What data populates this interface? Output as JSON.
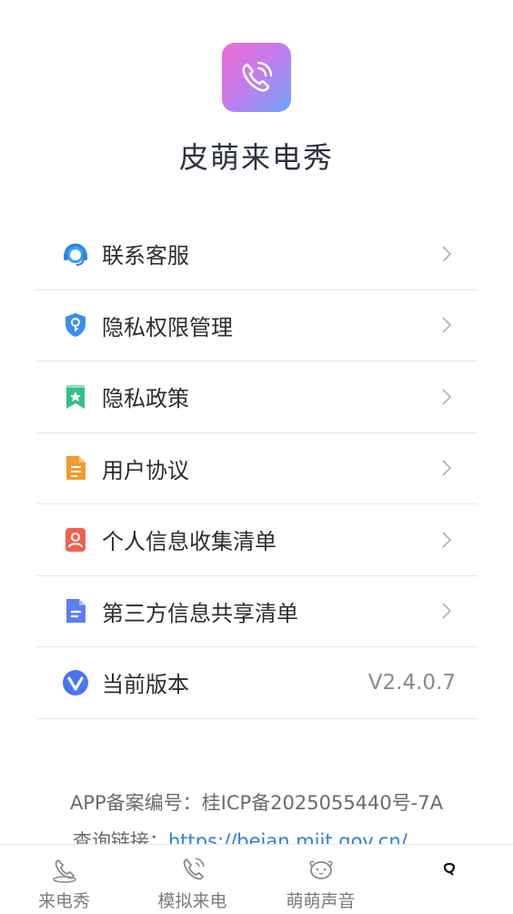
{
  "app": {
    "name": "皮萌来电秀",
    "icon": "phone-call-icon"
  },
  "menu": [
    {
      "label": "联系客服",
      "icon": "customer-service-icon",
      "color": "#3aa0f0",
      "trailing": "chevron"
    },
    {
      "label": "隐私权限管理",
      "icon": "shield-key-icon",
      "color": "#3d8cf0",
      "trailing": "chevron"
    },
    {
      "label": "隐私政策",
      "icon": "bookmark-star-icon",
      "color": "#34c08a",
      "trailing": "chevron"
    },
    {
      "label": "用户协议",
      "icon": "document-icon",
      "color": "#f29a2e",
      "trailing": "chevron"
    },
    {
      "label": "个人信息收集清单",
      "icon": "person-card-icon",
      "color": "#f0604f",
      "trailing": "chevron"
    },
    {
      "label": "第三方信息共享清单",
      "icon": "file-list-icon",
      "color": "#5b7ff0",
      "trailing": "chevron"
    },
    {
      "label": "当前版本",
      "icon": "version-v-icon",
      "color": "#4a74f0",
      "trailing": "value",
      "value": "V2.4.0.7"
    }
  ],
  "footer": {
    "icp": "APP备案编号：桂ICP备2025055440号-7A",
    "query_label": "查询链接：",
    "query_link": "https://beian.miit.gov.cn/"
  },
  "tabs": [
    {
      "label": "来电秀",
      "icon": "call-show-icon"
    },
    {
      "label": "模拟来电",
      "icon": "phone-ring-icon"
    },
    {
      "label": "萌萌声音",
      "icon": "pet-face-icon"
    },
    {
      "label": "",
      "icon": "profile-icon"
    }
  ],
  "colors": {
    "link": "#2f7fd8",
    "divider": "#e6e6e6"
  }
}
